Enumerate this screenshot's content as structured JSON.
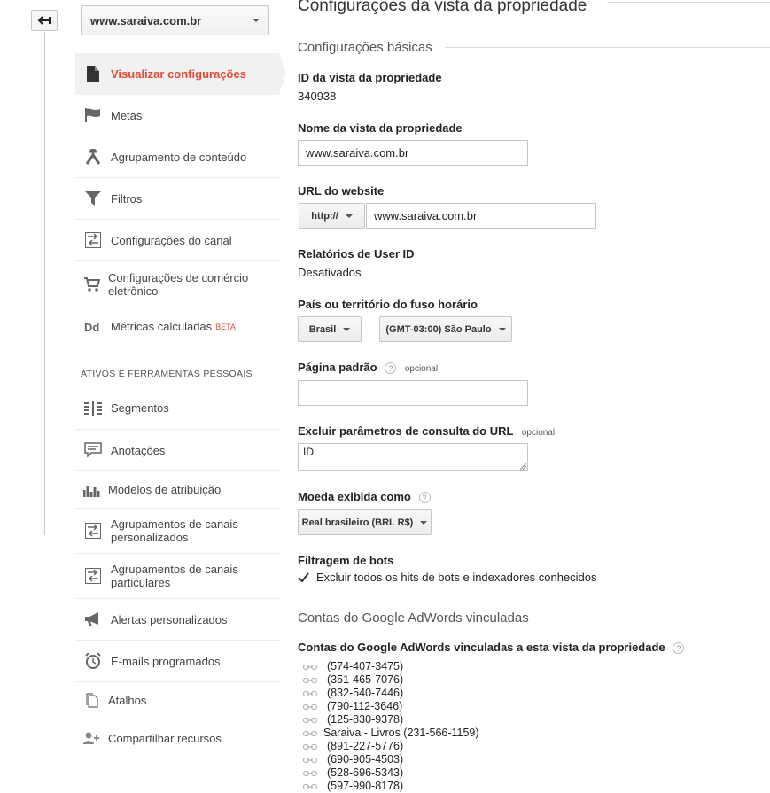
{
  "left_panel": {
    "property_select": "www.saraiva.com.br",
    "nav_items": [
      {
        "label": "Visualizar configurações",
        "icon": "document-icon"
      },
      {
        "label": "Metas",
        "icon": "flag-icon"
      },
      {
        "label": "Agrupamento de conteúdo",
        "icon": "merge-icon"
      },
      {
        "label": "Filtros",
        "icon": "filter-icon"
      },
      {
        "label": "Configurações do canal",
        "icon": "channel-icon"
      },
      {
        "label": "Configurações de comércio eletrônico",
        "icon": "cart-icon"
      },
      {
        "label": "Métricas calculadas",
        "badge": "BETA",
        "icon": "dd-icon"
      }
    ],
    "section_label": "ATIVOS E FERRAMENTAS PESSOAIS",
    "tool_items": [
      {
        "label": "Segmentos",
        "icon": "segments-icon"
      },
      {
        "label": "Anotações",
        "icon": "annotation-icon"
      },
      {
        "label": "Modelos de atribuição",
        "icon": "bar-chart-icon"
      },
      {
        "label": "Agrupamentos de canais personalizados",
        "icon": "channel-icon"
      },
      {
        "label": "Agrupamentos de canais particulares",
        "icon": "channel-icon"
      },
      {
        "label": "Alertas personalizados",
        "icon": "megaphone-icon"
      },
      {
        "label": "E-mails programados",
        "icon": "alarm-clock-icon"
      },
      {
        "label": "Atalhos",
        "icon": "pages-icon"
      },
      {
        "label": "Compartilhar recursos",
        "icon": "add-person-icon"
      }
    ]
  },
  "main": {
    "page_title": "Configurações da vista da propriedade",
    "basic_section": "Configurações básicas",
    "view_id_label": "ID da vista da propriedade",
    "view_id_value": "340938",
    "view_name_label": "Nome da vista da propriedade",
    "view_name_value": "www.saraiva.com.br",
    "website_url_label": "URL do website",
    "protocol": "http://",
    "website_url_value": "www.saraiva.com.br",
    "userid_label": "Relatórios de User ID",
    "userid_value": "Desativados",
    "timezone_label": "País ou território do fuso horário",
    "country": "Brasil",
    "timezone": "(GMT-03:00) São Paulo",
    "default_page_label": "Página padrão",
    "default_page_value": "",
    "optional": "opcional",
    "exclude_params_label": "Excluir parâmetros de consulta do URL",
    "exclude_params_value": "ID",
    "currency_label": "Moeda exibida como",
    "currency": "Real brasileiro (BRL R$)",
    "bot_filter_label": "Filtragem de bots",
    "bot_filter_text": "Excluir todos os hits de bots e indexadores conhecidos",
    "bot_filter_checked": true,
    "adwords_section": "Contas do Google AdWords vinculadas",
    "adwords_label": "Contas do Google AdWords vinculadas a esta vista da propriedade",
    "adwords_accounts": [
      "(574-407-3475)",
      "(351-465-7076)",
      "(832-540-7446)",
      "(790-112-3646)",
      "(125-830-9378)",
      "Saraiva - Livros (231-566-1159)",
      "(891-227-5776)",
      "(690-905-4503)",
      "(528-696-5343)",
      "(597-990-8178)"
    ]
  }
}
